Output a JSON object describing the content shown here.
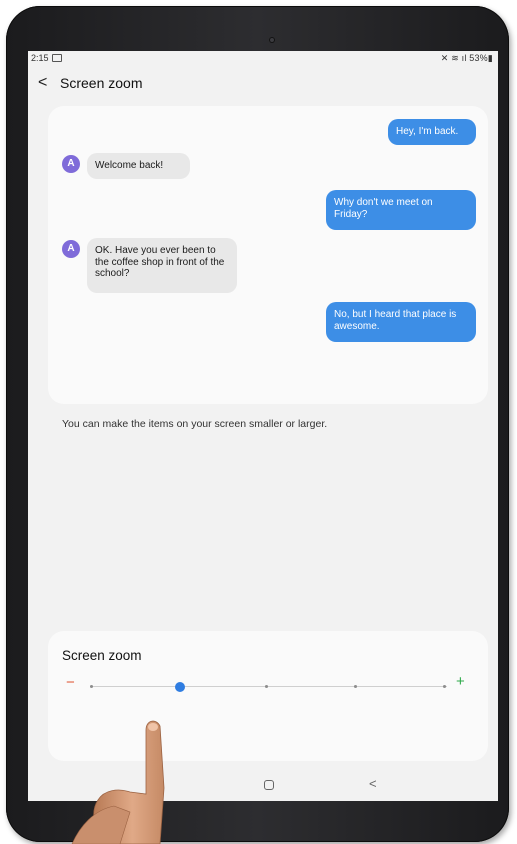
{
  "status_bar": {
    "time": "2:15",
    "right": "✕ ≋ ıl 53%▮"
  },
  "app_bar": {
    "back_icon": "chevron-left-icon",
    "title": "Screen zoom"
  },
  "preview": {
    "messages": [
      {
        "side": "out",
        "text": "Hey, I'm back."
      },
      {
        "side": "in",
        "avatar": "A",
        "text": "Welcome back!"
      },
      {
        "side": "out",
        "text": "Why don't we meet on Friday?"
      },
      {
        "side": "in",
        "avatar": "A",
        "text": "OK. Have you ever been to the coffee shop in front of the school?"
      },
      {
        "side": "out",
        "text": "No, but I heard that place is awesome."
      }
    ],
    "description": "You can make the items on your screen smaller or larger."
  },
  "zoom_control": {
    "title": "Screen zoom",
    "minus": "−",
    "plus": "+",
    "levels": 5,
    "selected_level": 2
  },
  "nav_bar": {
    "home_icon": "home-icon",
    "back_icon": "back-icon",
    "back_glyph": "<"
  },
  "colors": {
    "outgoing_bubble": "#3d8ee6",
    "incoming_bubble": "#e8e8e8",
    "avatar": "#7f6bd9",
    "slider_thumb": "#2f7de1",
    "minus": "#e05a3a",
    "plus": "#2eaa4a"
  }
}
